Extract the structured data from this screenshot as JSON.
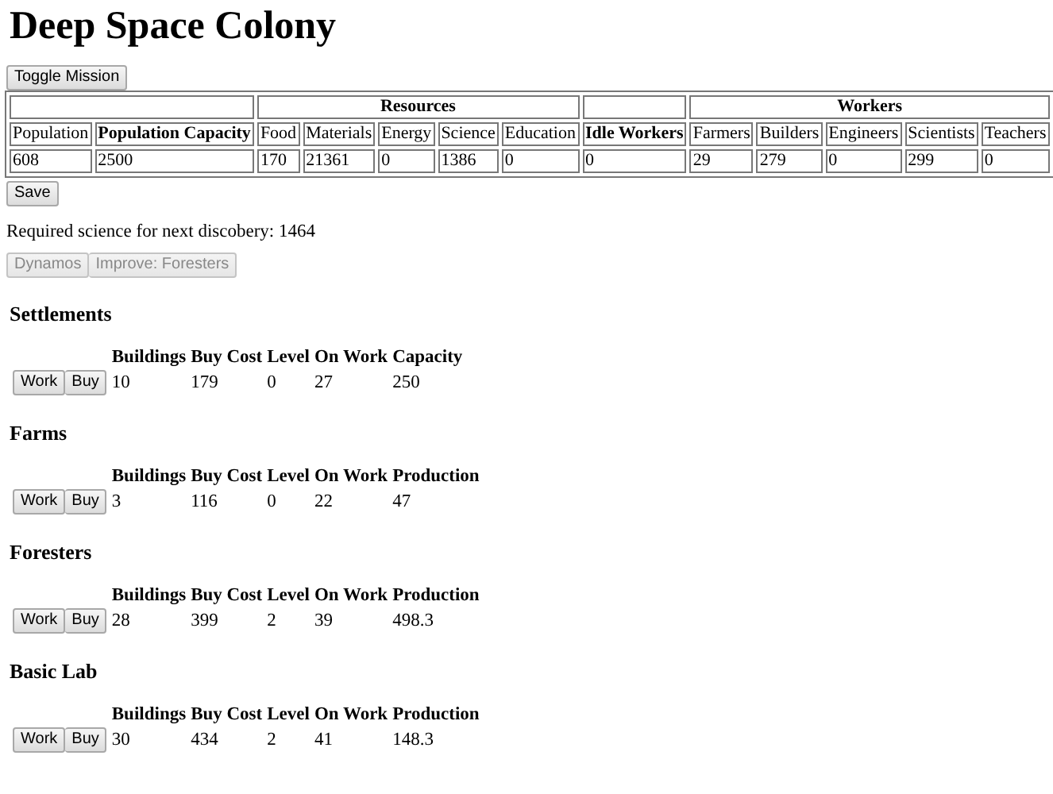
{
  "title": "Deep Space Colony",
  "toggle_button": "Toggle Mission",
  "stats": {
    "resources_group": "Resources",
    "workers_group": "Workers",
    "columns": [
      {
        "label": "Population",
        "bold": false
      },
      {
        "label": "Population Capacity",
        "bold": true
      },
      {
        "label": "Food",
        "bold": false
      },
      {
        "label": "Materials",
        "bold": false
      },
      {
        "label": "Energy",
        "bold": false
      },
      {
        "label": "Science",
        "bold": false
      },
      {
        "label": "Education",
        "bold": false
      },
      {
        "label": "Idle Workers",
        "bold": true
      },
      {
        "label": "Farmers",
        "bold": false
      },
      {
        "label": "Builders",
        "bold": false
      },
      {
        "label": "Engineers",
        "bold": false
      },
      {
        "label": "Scientists",
        "bold": false
      },
      {
        "label": "Teachers",
        "bold": false
      }
    ],
    "values": [
      "608",
      "2500",
      "170",
      "21361",
      "0",
      "1386",
      "0",
      "0",
      "29",
      "279",
      "0",
      "299",
      "0"
    ]
  },
  "save_button": "Save",
  "science_note": "Required science for next discobery: 1464",
  "research_buttons": [
    {
      "label": "Dynamos",
      "disabled": true
    },
    {
      "label": "Improve: Foresters",
      "disabled": true
    }
  ],
  "buildings": [
    {
      "name": "Settlements",
      "work_button": "Work",
      "buy_button": "Buy",
      "columns": [
        "Buildings",
        "Buy Cost",
        "Level",
        "On Work",
        "Capacity"
      ],
      "values": [
        "10",
        "179",
        "0",
        "27",
        "250"
      ]
    },
    {
      "name": "Farms",
      "work_button": "Work",
      "buy_button": "Buy",
      "columns": [
        "Buildings",
        "Buy Cost",
        "Level",
        "On Work",
        "Production"
      ],
      "values": [
        "3",
        "116",
        "0",
        "22",
        "47"
      ]
    },
    {
      "name": "Foresters",
      "work_button": "Work",
      "buy_button": "Buy",
      "columns": [
        "Buildings",
        "Buy Cost",
        "Level",
        "On Work",
        "Production"
      ],
      "values": [
        "28",
        "399",
        "2",
        "39",
        "498.3"
      ]
    },
    {
      "name": "Basic Lab",
      "work_button": "Work",
      "buy_button": "Buy",
      "columns": [
        "Buildings",
        "Buy Cost",
        "Level",
        "On Work",
        "Production"
      ],
      "values": [
        "30",
        "434",
        "2",
        "41",
        "148.3"
      ]
    }
  ]
}
